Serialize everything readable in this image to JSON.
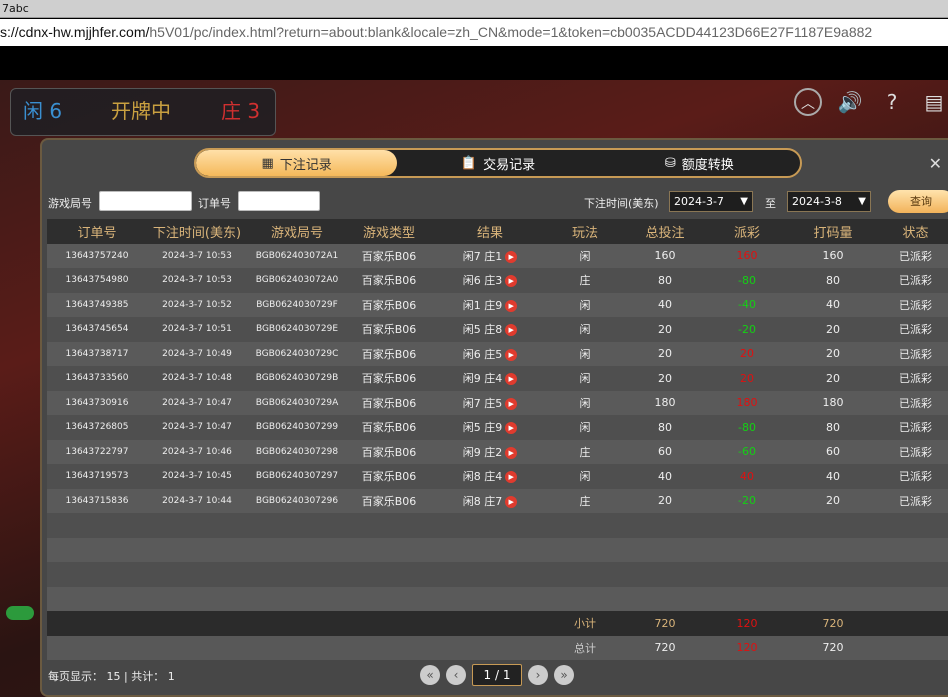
{
  "browser": {
    "title": "7abc",
    "url_host": "s://cdnx-hw.mjjhfer.com/",
    "url_rest": "h5V01/pc/index.html?return=about:blank&locale=zh_CN&mode=1&token=cb0035ACDD44123D66E27F1187E9a882"
  },
  "game": {
    "player": "闲 6",
    "status": "开牌中",
    "banker": "庄 3"
  },
  "tabs": [
    {
      "label": "下注记录",
      "icon": "calendar-icon"
    },
    {
      "label": "交易记录",
      "icon": "clipboard-icon"
    },
    {
      "label": "额度转换",
      "icon": "coins-icon"
    }
  ],
  "filter": {
    "round_label": "游戏局号",
    "order_label": "订单号",
    "time_label": "下注时间(美东)",
    "from": "2024-3-7",
    "to_label": "至",
    "to": "2024-3-8",
    "query": "查询"
  },
  "headers": [
    "订单号",
    "下注时间(美东)",
    "游戏局号",
    "游戏类型",
    "结果",
    "玩法",
    "总投注",
    "派彩",
    "打码量",
    "状态"
  ],
  "rows": [
    [
      "13643757240",
      "2024-3-7 10:53",
      "BGB062403072A1",
      "百家乐B06",
      "闲7 庄1",
      "闲",
      "160",
      "160",
      "160",
      "已派彩"
    ],
    [
      "13643754980",
      "2024-3-7 10:53",
      "BGB062403072A0",
      "百家乐B06",
      "闲6 庄3",
      "庄",
      "80",
      "-80",
      "80",
      "已派彩"
    ],
    [
      "13643749385",
      "2024-3-7 10:52",
      "BGB0624030729F",
      "百家乐B06",
      "闲1 庄9",
      "闲",
      "40",
      "-40",
      "40",
      "已派彩"
    ],
    [
      "13643745654",
      "2024-3-7 10:51",
      "BGB0624030729E",
      "百家乐B06",
      "闲5 庄8",
      "闲",
      "20",
      "-20",
      "20",
      "已派彩"
    ],
    [
      "13643738717",
      "2024-3-7 10:49",
      "BGB0624030729C",
      "百家乐B06",
      "闲6 庄5",
      "闲",
      "20",
      "20",
      "20",
      "已派彩"
    ],
    [
      "13643733560",
      "2024-3-7 10:48",
      "BGB0624030729B",
      "百家乐B06",
      "闲9 庄4",
      "闲",
      "20",
      "20",
      "20",
      "已派彩"
    ],
    [
      "13643730916",
      "2024-3-7 10:47",
      "BGB0624030729A",
      "百家乐B06",
      "闲7 庄5",
      "闲",
      "180",
      "180",
      "180",
      "已派彩"
    ],
    [
      "13643726805",
      "2024-3-7 10:47",
      "BGB06240307299",
      "百家乐B06",
      "闲5 庄9",
      "闲",
      "80",
      "-80",
      "80",
      "已派彩"
    ],
    [
      "13643722797",
      "2024-3-7 10:46",
      "BGB06240307298",
      "百家乐B06",
      "闲9 庄2",
      "庄",
      "60",
      "-60",
      "60",
      "已派彩"
    ],
    [
      "13643719573",
      "2024-3-7 10:45",
      "BGB06240307297",
      "百家乐B06",
      "闲8 庄4",
      "闲",
      "40",
      "40",
      "40",
      "已派彩"
    ],
    [
      "13643715836",
      "2024-3-7 10:44",
      "BGB06240307296",
      "百家乐B06",
      "闲8 庄7",
      "庄",
      "20",
      "-20",
      "20",
      "已派彩"
    ]
  ],
  "subtotal": {
    "label": "小计",
    "bet": "720",
    "payout": "120",
    "valid": "720"
  },
  "total": {
    "label": "总计",
    "bet": "720",
    "payout": "120",
    "valid": "720"
  },
  "footer": {
    "per_page": "每页显示： 15 | 共计： 1"
  },
  "pager": {
    "page": "1 / 1"
  },
  "colors": {
    "win": "#e01010",
    "lose": "#14d014",
    "accent": "#d9b47a"
  }
}
